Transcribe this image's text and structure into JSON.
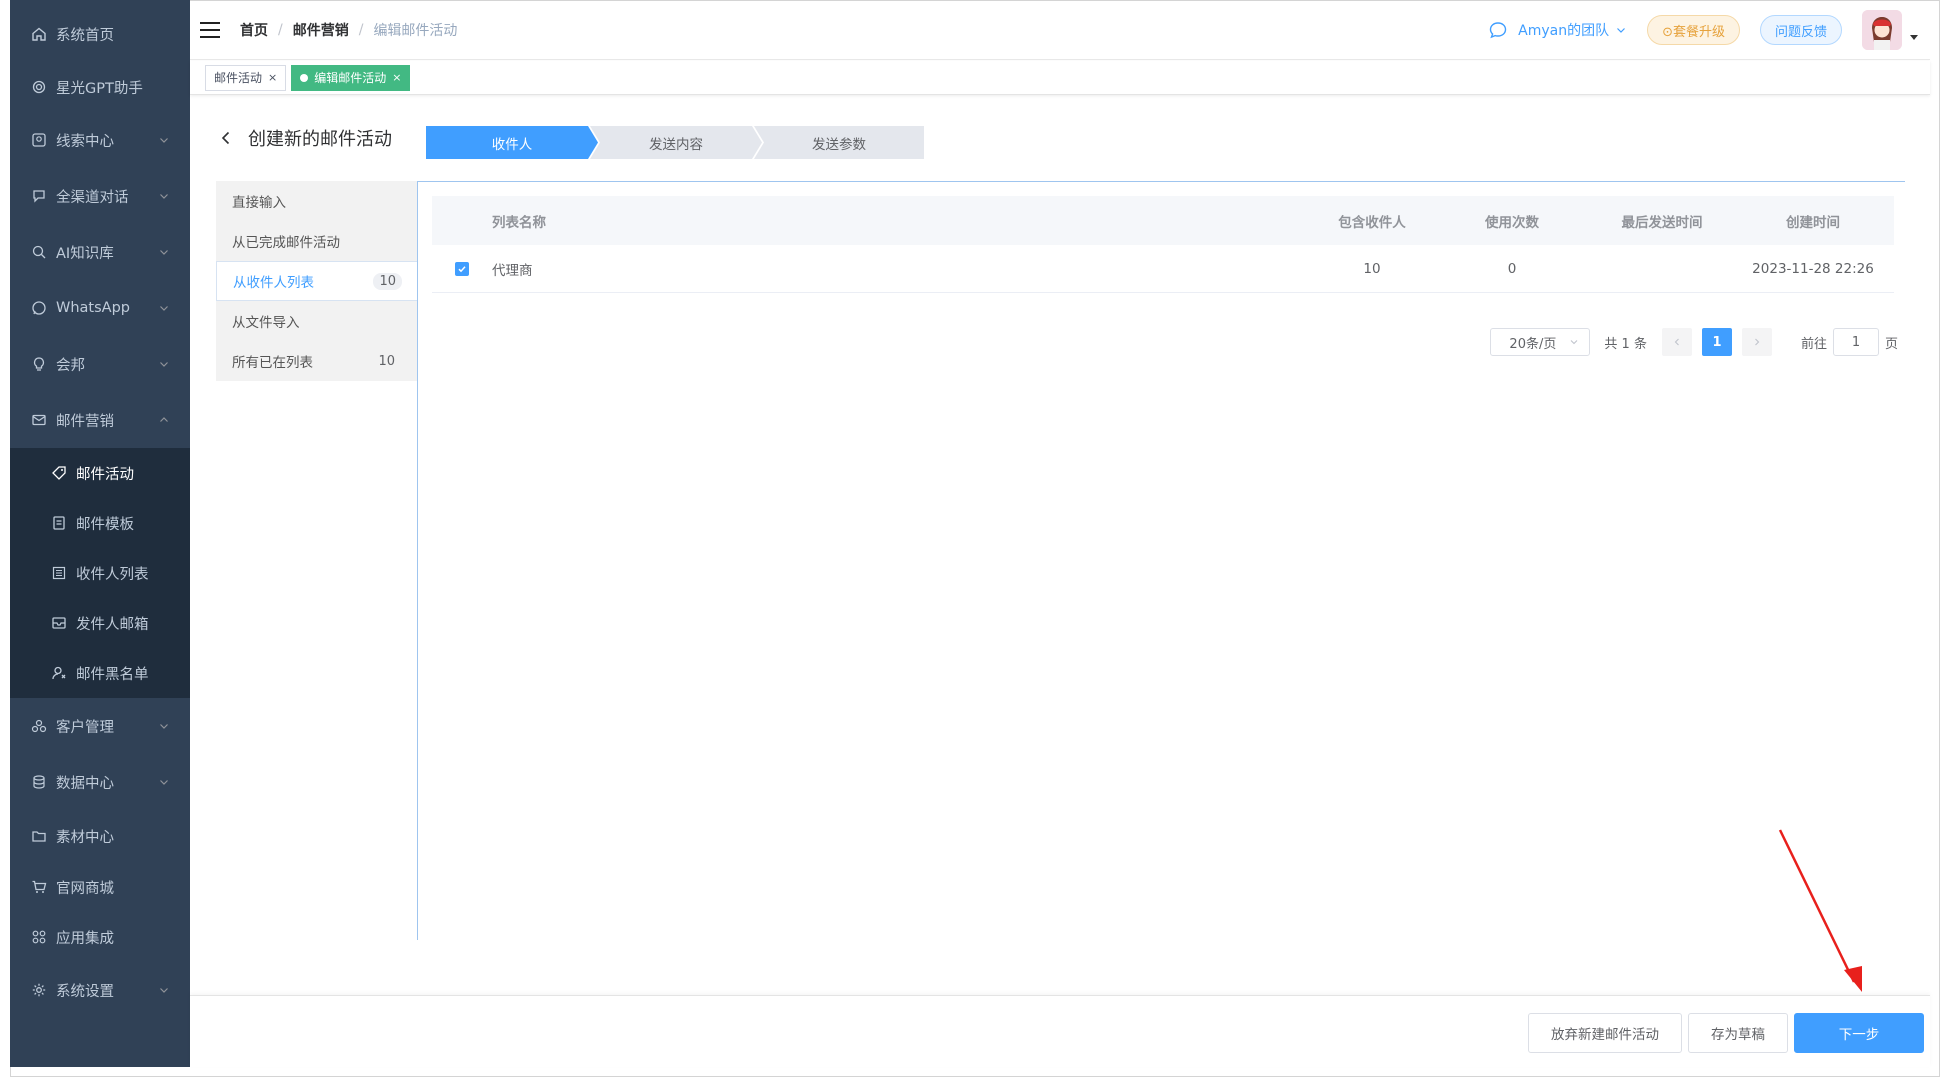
{
  "sidebar": {
    "items": [
      {
        "label": "系统首页",
        "icon": "home-icon",
        "arrow": false
      },
      {
        "label": "星光GPT助手",
        "icon": "openai-icon",
        "arrow": false
      },
      {
        "label": "线索中心",
        "icon": "lead-icon",
        "arrow": true
      },
      {
        "label": "全渠道对话",
        "icon": "chat-icon",
        "arrow": true
      },
      {
        "label": "AI知识库",
        "icon": "knowledge-icon",
        "arrow": true
      },
      {
        "label": "WhatsApp",
        "icon": "whatsapp-icon",
        "arrow": true
      },
      {
        "label": "会邦",
        "icon": "bulb-icon",
        "arrow": true
      },
      {
        "label": "邮件营销",
        "icon": "mail-icon",
        "arrow": true
      }
    ],
    "sub_items": [
      {
        "label": "邮件活动",
        "icon": "tag-icon"
      },
      {
        "label": "邮件模板",
        "icon": "template-icon"
      },
      {
        "label": "收件人列表",
        "icon": "list-icon"
      },
      {
        "label": "发件人邮箱",
        "icon": "inbox-icon"
      },
      {
        "label": "邮件黑名单",
        "icon": "user-block-icon"
      }
    ],
    "items_after": [
      {
        "label": "客户管理",
        "icon": "customers-icon",
        "arrow": true
      },
      {
        "label": "数据中心",
        "icon": "database-icon",
        "arrow": true
      },
      {
        "label": "素材中心",
        "icon": "folder-icon",
        "arrow": false
      },
      {
        "label": "官网商城",
        "icon": "cart-icon",
        "arrow": false
      },
      {
        "label": "应用集成",
        "icon": "apps-icon",
        "arrow": false
      },
      {
        "label": "系统设置",
        "icon": "gear-icon",
        "arrow": true
      }
    ]
  },
  "breadcrumb": {
    "home": "首页",
    "section": "邮件营销",
    "current": "编辑邮件活动",
    "sep": "/"
  },
  "topbar": {
    "team": "Amyan的团队",
    "upgrade": "⊙套餐升级",
    "feedback": "问题反馈"
  },
  "tags": [
    {
      "label": "邮件活动",
      "close": "×"
    },
    {
      "label": "编辑邮件活动",
      "close": "×"
    }
  ],
  "page": {
    "title": "创建新的邮件活动"
  },
  "steps": [
    "收件人",
    "发送内容",
    "发送参数"
  ],
  "source_tabs": [
    {
      "label": "直接输入",
      "count": ""
    },
    {
      "label": "从已完成邮件活动",
      "count": ""
    },
    {
      "label": "从收件人列表",
      "count": "10"
    },
    {
      "label": "从文件导入",
      "count": ""
    },
    {
      "label": "所有已在列表",
      "count": "10"
    }
  ],
  "table": {
    "headers": [
      "列表名称",
      "包含收件人",
      "使用次数",
      "最后发送时间",
      "创建时间"
    ],
    "rows": [
      {
        "name": "代理商",
        "recipients": "10",
        "uses": "0",
        "last_sent": "",
        "created": "2023-11-28 22:26",
        "checked": true
      }
    ]
  },
  "pagination": {
    "page_size": "20条/页",
    "total": "共 1 条",
    "current": "1",
    "goto_label": "前往",
    "goto_value": "1",
    "page_suffix": "页"
  },
  "footer": {
    "discard": "放弃新建邮件活动",
    "draft": "存为草稿",
    "next": "下一步"
  },
  "colors": {
    "sidebar_bg": "#304156",
    "submenu_bg": "#1f2d3d",
    "primary": "#409eff",
    "active_tag": "#42b983",
    "annotation_arrow": "#e8201c"
  }
}
